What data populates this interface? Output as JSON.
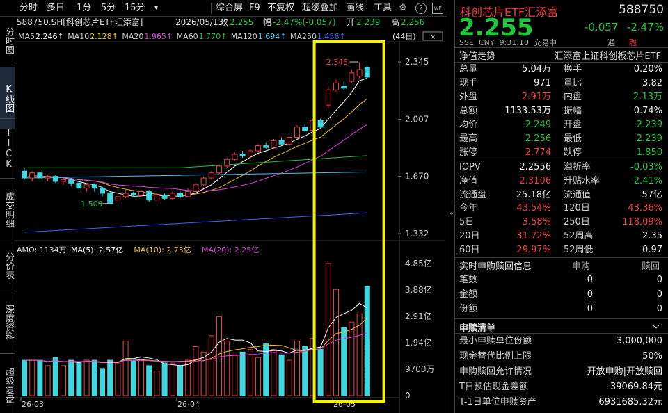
{
  "toolbar": {
    "items": [
      "分时",
      "多日",
      "1分",
      "5分",
      "15分",
      "综合屏",
      "F9",
      "不复权",
      "超级叠加",
      "画线",
      "工具"
    ],
    "gear": "⚙",
    "help": "?",
    "wp": "WP"
  },
  "left_tabs": [
    "分时图",
    "K线图",
    "TICK",
    "成交明细",
    "分价表",
    "深度资料",
    "超级复盘"
  ],
  "chart": {
    "title": "588750.SH[科创芯片ETF汇添富]",
    "date": "2026/05/13",
    "close_lbl": "收",
    "close": "2.255",
    "amp_lbl": "幅",
    "change": "-2.47%(-0.057)",
    "open_lbl": "开",
    "open": "2.239",
    "high_lbl": "高",
    "high": "2.256",
    "ma": [
      {
        "t": "MA5",
        "v": "2.246↑",
        "c": "#ffffff"
      },
      {
        "t": "MA10",
        "v": "2.128↑",
        "c": "#f0c020"
      },
      {
        "t": "MA20",
        "v": "1.965↑",
        "c": "#e040e0"
      },
      {
        "t": "MA60",
        "v": "1.770↑",
        "c": "#20c040"
      },
      {
        "t": "MA120",
        "v": "1.694↑",
        "c": "#40c8f0"
      },
      {
        "t": "MA250",
        "v": "1.456↑",
        "c": "#4060ff"
      }
    ],
    "days": "(44日)",
    "price_axis": [
      "2.345",
      "2.007",
      "1.670",
      "1.332"
    ],
    "hi_label": "2.345",
    "lo_label": "1.509",
    "vol_title": "AMO: 1134万",
    "vol_ma": [
      {
        "t": "MA(5): 2.57亿",
        "c": "#ffffff"
      },
      {
        "t": "MA(10): 2.73亿",
        "c": "#f0c020"
      },
      {
        "t": "MA(20): 2.25亿",
        "c": "#e040e0"
      }
    ],
    "vol_axis": [
      "4.85亿",
      "3.88亿",
      "2.91亿",
      "1.94亿",
      "9700万",
      "0"
    ],
    "x_axis": [
      "26-03",
      "26-04",
      "26-05"
    ]
  },
  "chart_data": {
    "type": "candlestick",
    "candles": [
      [
        1.7,
        1.66,
        1.72,
        1.65
      ],
      [
        1.66,
        1.69,
        1.7,
        1.64
      ],
      [
        1.69,
        1.66,
        1.7,
        1.65
      ],
      [
        1.66,
        1.67,
        1.68,
        1.64
      ],
      [
        1.67,
        1.64,
        1.68,
        1.63
      ],
      [
        1.64,
        1.65,
        1.66,
        1.62
      ],
      [
        1.65,
        1.63,
        1.66,
        1.61
      ],
      [
        1.63,
        1.6,
        1.64,
        1.59
      ],
      [
        1.6,
        1.62,
        1.63,
        1.58
      ],
      [
        1.62,
        1.6,
        1.63,
        1.58
      ],
      [
        1.6,
        1.57,
        1.61,
        1.55
      ],
      [
        1.57,
        1.51,
        1.58,
        1.509
      ],
      [
        1.53,
        1.55,
        1.57,
        1.52
      ],
      [
        1.55,
        1.57,
        1.59,
        1.54
      ],
      [
        1.57,
        1.56,
        1.58,
        1.55
      ],
      [
        1.56,
        1.58,
        1.59,
        1.55
      ],
      [
        1.58,
        1.53,
        1.59,
        1.52
      ],
      [
        1.53,
        1.56,
        1.57,
        1.52
      ],
      [
        1.56,
        1.54,
        1.57,
        1.53
      ],
      [
        1.54,
        1.57,
        1.58,
        1.53
      ],
      [
        1.57,
        1.55,
        1.58,
        1.54
      ],
      [
        1.55,
        1.58,
        1.6,
        1.55
      ],
      [
        1.58,
        1.62,
        1.63,
        1.57
      ],
      [
        1.62,
        1.66,
        1.67,
        1.61
      ],
      [
        1.66,
        1.69,
        1.7,
        1.65
      ],
      [
        1.69,
        1.73,
        1.74,
        1.68
      ],
      [
        1.73,
        1.77,
        1.78,
        1.72
      ],
      [
        1.77,
        1.8,
        1.81,
        1.76
      ],
      [
        1.8,
        1.79,
        1.82,
        1.78
      ],
      [
        1.79,
        1.82,
        1.83,
        1.78
      ],
      [
        1.82,
        1.85,
        1.86,
        1.81
      ],
      [
        1.85,
        1.84,
        1.87,
        1.83
      ],
      [
        1.84,
        1.88,
        1.89,
        1.83
      ],
      [
        1.88,
        1.86,
        1.9,
        1.85
      ],
      [
        1.86,
        1.9,
        1.91,
        1.85
      ],
      [
        1.9,
        1.96,
        1.97,
        1.89
      ],
      [
        1.96,
        1.94,
        1.98,
        1.93
      ],
      [
        1.94,
        2.0,
        2.01,
        1.93
      ],
      [
        2.0,
        1.96,
        2.01,
        1.95
      ],
      [
        2.09,
        2.18,
        2.2,
        2.07
      ],
      [
        2.18,
        2.22,
        2.24,
        2.17
      ],
      [
        2.2,
        2.19,
        2.23,
        2.18
      ],
      [
        2.23,
        2.28,
        2.3,
        2.22
      ],
      [
        2.26,
        2.3,
        2.345,
        2.25
      ],
      [
        2.312,
        2.255,
        2.32,
        2.25
      ]
    ],
    "volume_yi": [
      1.3,
      1.3,
      1.3,
      1.1,
      1.4,
      1.1,
      1.3,
      1.2,
      1.3,
      1.3,
      1.0,
      1.3,
      1.2,
      2.0,
      1.3,
      1.3,
      1.1,
      0.9,
      1.2,
      1.2,
      1.1,
      1.3,
      1.8,
      1.6,
      2.2,
      2.9,
      2.0,
      1.5,
      1.6,
      1.7,
      1.4,
      1.9,
      1.7,
      1.5,
      1.3,
      2.0,
      1.8,
      2.1,
      1.7,
      4.85,
      3.9,
      2.5,
      2.7,
      3.0,
      4.0,
      0.1
    ],
    "ylim_price": [
      1.332,
      2.345
    ],
    "ylim_vol": [
      0,
      4.85
    ],
    "x_ticks": [
      "26-03",
      "26-04",
      "26-05"
    ]
  },
  "quote": {
    "name": "科创芯片ETF汇添富",
    "code": "588750",
    "price": "2.255",
    "chg": "-0.057",
    "pct": "-2.47%",
    "sub": [
      "SSE",
      "CNY",
      "9:31:10",
      "交易中"
    ],
    "sub_right": [
      "通",
      "融"
    ],
    "nav_title": "净值走势",
    "nav_name": "汇添富上证科创板芯片ETF",
    "rows1": [
      [
        "总量",
        "5.04万",
        "white",
        "换手",
        "0.20%",
        "white"
      ],
      [
        "现手",
        "971",
        "white",
        "量比",
        "3.82",
        "white"
      ],
      [
        "外盘",
        "2.91万",
        "red",
        "内盘",
        "2.13万",
        "green"
      ],
      [
        "总额",
        "1133.53万",
        "white",
        "振幅",
        "0.74%",
        "white"
      ],
      [
        "均价",
        "2.249",
        "green",
        "开盘",
        "2.239",
        "green"
      ],
      [
        "最高",
        "2.256",
        "green",
        "最低",
        "2.239",
        "green"
      ],
      [
        "涨停",
        "2.774",
        "red",
        "跌停",
        "1.850",
        "green"
      ]
    ],
    "rows2": [
      [
        "IOPV",
        "2.2556",
        "white",
        "溢折率",
        "-0.03%",
        "green"
      ],
      [
        "净值",
        "2.3106",
        "red",
        "升贴水率",
        "-2.41%",
        "green"
      ],
      [
        "流通盘",
        "25.18亿",
        "white",
        "流通值",
        "57亿",
        "white"
      ]
    ],
    "rows3": [
      [
        "今年",
        "43.54%",
        "red",
        "120日",
        "43.36%",
        "red"
      ],
      [
        "5日",
        "3.58%",
        "red",
        "250日",
        "118.09%",
        "red"
      ],
      [
        "20日",
        "31.72%",
        "red",
        "52周高",
        "2.35",
        "white"
      ],
      [
        "60日",
        "29.97%",
        "red",
        "52周低",
        "0.97",
        "white"
      ]
    ],
    "realtime": {
      "title": "实时申购赎回信息",
      "h1": "申购",
      "h2": "赎回",
      "rows": [
        [
          "笔数",
          "0",
          "0"
        ],
        [
          "金额",
          "0",
          "0"
        ],
        [
          "份额",
          "0",
          "0"
        ]
      ]
    },
    "sub_redeem": {
      "title": "申赎清单",
      "rows": [
        [
          "最小申赎单位份额",
          "3,000,000"
        ],
        [
          "现金替代比例上限",
          "50%"
        ],
        [
          "申购赎回允许情况",
          "开放申购|开放赎回"
        ],
        [
          "T日预估现金差额",
          "-39069.84元"
        ],
        [
          "T-1日单位申赎资产",
          "6931685.32元"
        ]
      ]
    },
    "collapse": "»"
  }
}
